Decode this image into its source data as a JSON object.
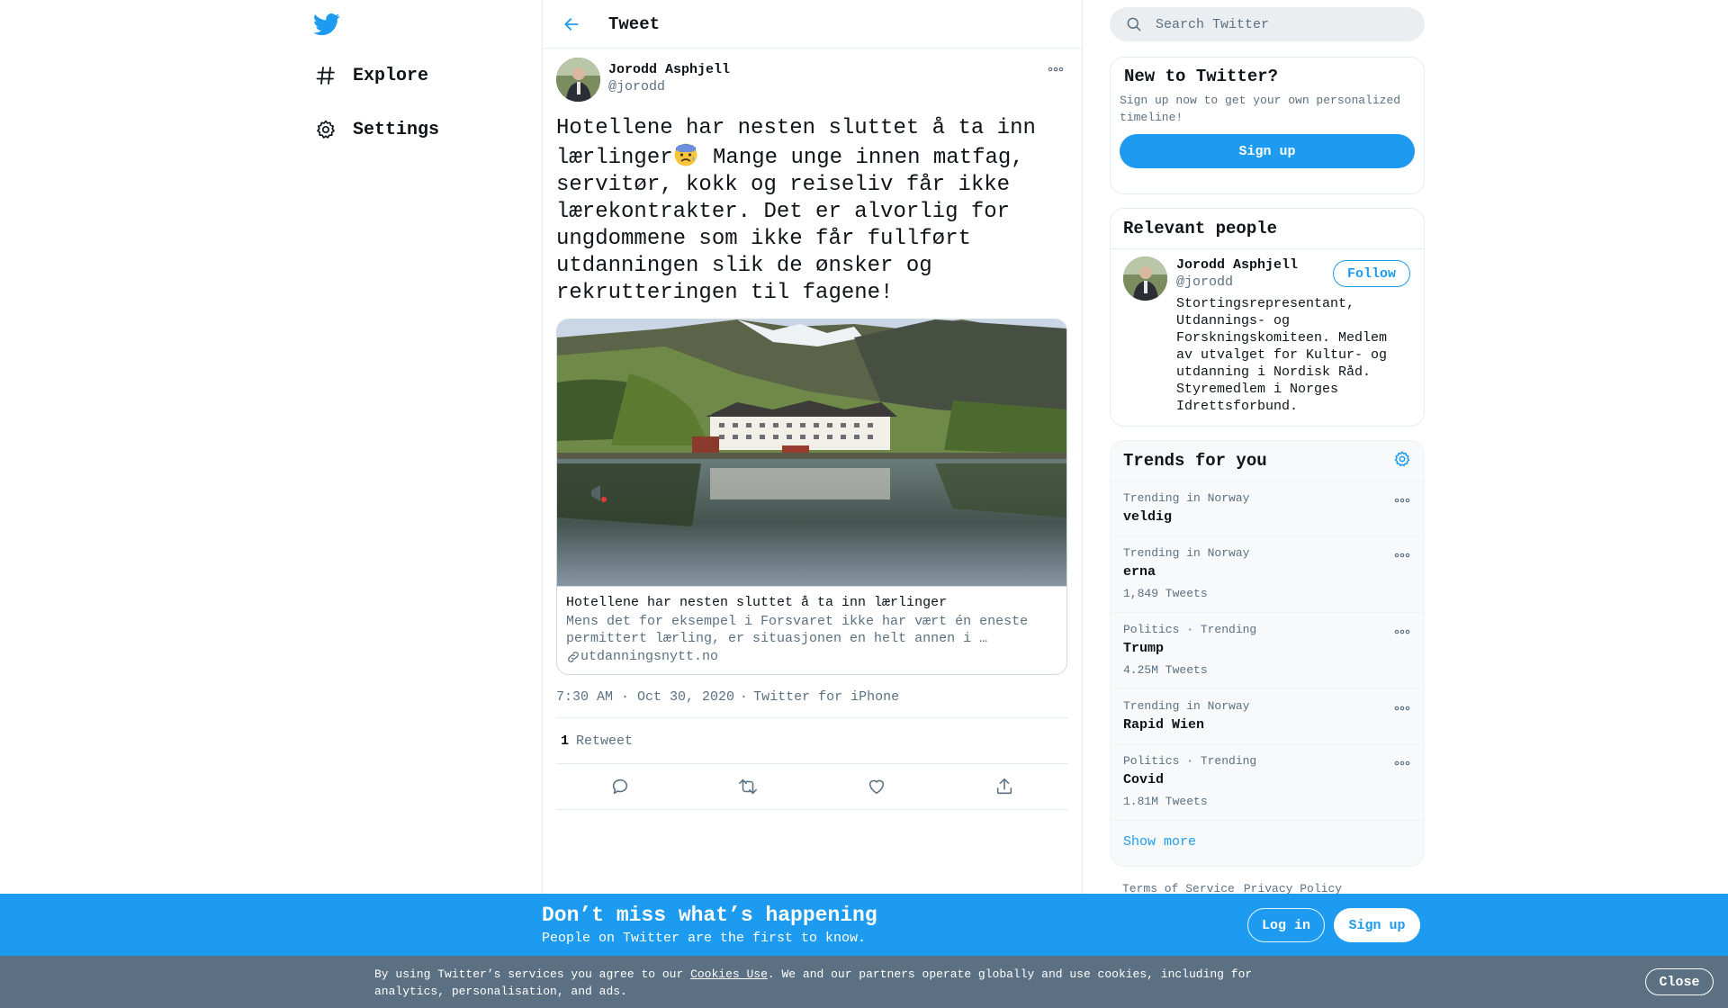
{
  "colors": {
    "accent": "#1d9bf0",
    "text": "#0f1419",
    "secondary": "#5b7083",
    "cookie_bg": "#5b7083"
  },
  "nav": {
    "logo_icon": "twitter-bird-icon",
    "items": [
      {
        "label": "Explore",
        "icon": "hashtag-icon"
      },
      {
        "label": "Settings",
        "icon": "gear-icon"
      }
    ]
  },
  "header": {
    "title": "Tweet",
    "back_icon": "arrow-left-icon"
  },
  "tweet": {
    "author_name": "Jorodd Asphjell",
    "author_handle": "@jorodd",
    "text_before_emoji": "Hotellene har nesten sluttet å ta inn lærlinger",
    "emoji_icon": "anxious-face-emoji",
    "text_after_emoji": " Mange unge innen matfag, servitør, kokk og reiseliv får ikke lærekontrakter. Det er alvorlig for ungdommene som ikke får fullført utdanningen slik de ønsker og rekrutteringen til fagene!",
    "card": {
      "title": "Hotellene har nesten sluttet å ta inn lærlinger",
      "description": "Mens det for eksempel i Forsvaret ikke har vært én eneste permittert lærling, er situasjonen en helt annen i …",
      "domain": "utdanningsnytt.no"
    },
    "time": "7:30 AM · Oct 30, 2020",
    "separator": "·",
    "source": "Twitter for iPhone",
    "retweet_count": "1",
    "retweet_label": "Retweet"
  },
  "search": {
    "placeholder": "Search Twitter"
  },
  "new_to_twitter": {
    "title": "New to Twitter?",
    "description": "Sign up now to get your own personalized timeline!",
    "button": "Sign up"
  },
  "relevant": {
    "title": "Relevant people",
    "name": "Jorodd Asphjell",
    "handle": "@jorodd",
    "bio": "Stortingsrepresentant, Utdannings- og Forskningskomiteen. Medlem av utvalget for Kultur- og utdanning i Nordisk Råd. Styremedlem i Norges Idrettsforbund.",
    "follow": "Follow"
  },
  "trends": {
    "title": "Trends for you",
    "items": [
      {
        "context": "Trending in Norway",
        "name": "veldig",
        "count": ""
      },
      {
        "context": "Trending in Norway",
        "name": "erna",
        "count": "1,849 Tweets"
      },
      {
        "context": "Politics · Trending",
        "name": "Trump",
        "count": "4.25M Tweets"
      },
      {
        "context": "Trending in Norway",
        "name": "Rapid Wien",
        "count": ""
      },
      {
        "context": "Politics · Trending",
        "name": "Covid",
        "count": "1.81M Tweets"
      }
    ],
    "show_more": "Show more"
  },
  "footer": {
    "terms": "Terms of Service",
    "privacy": "Privacy Policy"
  },
  "dont_miss": {
    "title": "Don’t miss what’s happening",
    "subtitle": "People on Twitter are the first to know.",
    "login": "Log in",
    "signup": "Sign up"
  },
  "cookie": {
    "text_before": "By using Twitter’s services you agree to our ",
    "link": "Cookies Use",
    "text_after": ". We and our partners operate globally and use cookies, including for analytics, personalisation, and ads.",
    "close": "Close"
  }
}
